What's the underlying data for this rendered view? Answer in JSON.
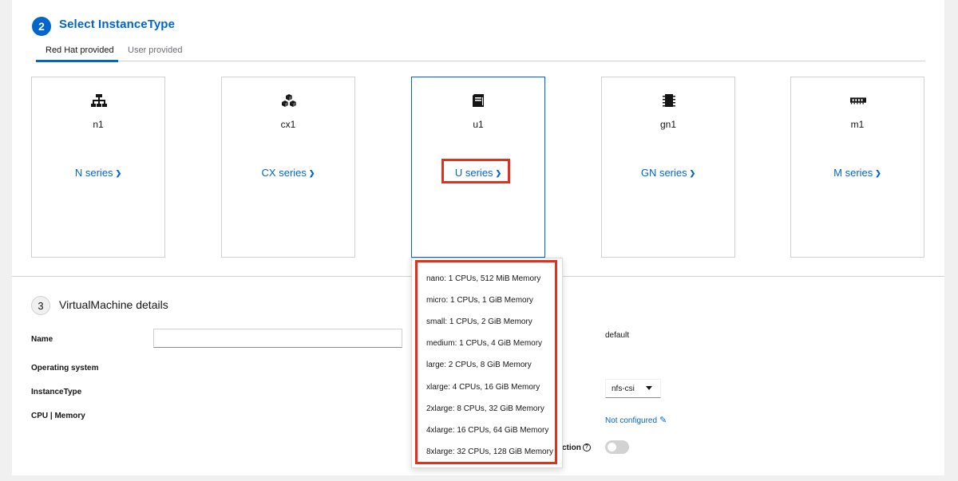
{
  "step2": {
    "number": "2",
    "title": "Select InstanceType",
    "tabs": [
      "Red Hat provided",
      "User provided"
    ]
  },
  "cards": [
    {
      "name": "n1",
      "series": "N series",
      "icon": "sitemap-icon"
    },
    {
      "name": "cx1",
      "series": "CX series",
      "icon": "cubes-icon"
    },
    {
      "name": "u1",
      "series": "U series",
      "icon": "server-icon"
    },
    {
      "name": "gn1",
      "series": "GN series",
      "icon": "chip-icon"
    },
    {
      "name": "m1",
      "series": "M series",
      "icon": "memory-icon"
    }
  ],
  "step3": {
    "number": "3",
    "title": "VirtualMachine details",
    "labels": {
      "name": "Name",
      "os": "Operating system",
      "instancetype": "InstanceType",
      "cpu_memory": "CPU | Memory"
    },
    "name_value": "",
    "right": {
      "namespace": "default",
      "storage_class": "nfs-csi",
      "not_configured": "Not configured",
      "partial_label": "ction"
    }
  },
  "dropdown": {
    "items": [
      "nano: 1 CPUs, 512 MiB Memory",
      "micro: 1 CPUs, 1 GiB Memory",
      "small: 1 CPUs, 2 GiB Memory",
      "medium: 1 CPUs, 4 GiB Memory",
      "large: 2 CPUs, 8 GiB Memory",
      "xlarge: 4 CPUs, 16 GiB Memory",
      "2xlarge: 8 CPUs, 32 GiB Memory",
      "4xlarge: 16 CPUs, 64 GiB Memory",
      "8xlarge: 32 CPUs, 128 GiB Memory"
    ]
  },
  "colors": {
    "accent": "#0066cc",
    "highlight": "#e0311f"
  }
}
